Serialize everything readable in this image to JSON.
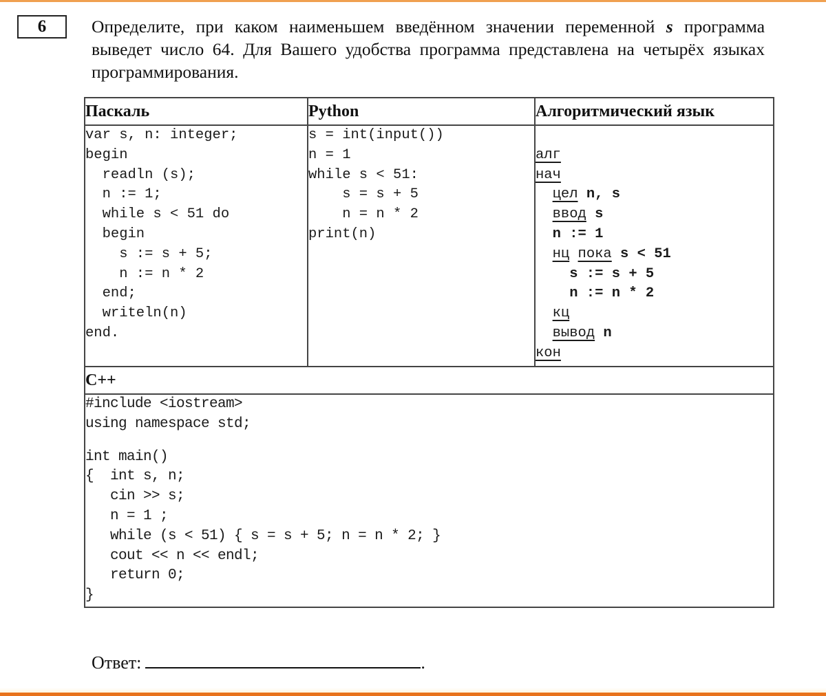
{
  "task": {
    "number": "6",
    "question_part1": "Определите, при каком наименьшем введённом значении переменной ",
    "question_var": "s",
    "question_part2": " программа выведет число 64. Для Вашего удобства программа представлена на четырёх языках программирования."
  },
  "table": {
    "headers": {
      "pascal": "Паскаль",
      "python": "Python",
      "algo": "Алгоритмический язык",
      "cpp": "C++"
    },
    "pascal_lines": [
      "var s, n: integer;",
      "begin",
      "  readln (s);",
      "  n := 1;",
      "  while s < 51 do",
      "  begin",
      "    s := s + 5;",
      "    n := n * 2",
      "  end;",
      "  writeln(n)",
      "end."
    ],
    "python_lines": [
      "s = int(input())",
      "n = 1",
      "while s < 51:",
      "    s = s + 5",
      "    n = n * 2",
      "print(n)"
    ],
    "algo": {
      "l1_kw": "алг",
      "l2_kw": "нач",
      "l3_kw": "цел",
      "l3_rest": " n, s",
      "l4_kw": "ввод",
      "l4_rest": " s",
      "l5": "  n := 1",
      "l6_kw1": "нц",
      "l6_kw2": "пока",
      "l6_rest": " s < 51",
      "l7": "    s := s + 5",
      "l8": "    n := n * 2",
      "l9_kw": "кц",
      "l10_kw": "вывод",
      "l10_rest": " n",
      "l11_kw": "кон"
    },
    "cpp_lines_head": [
      "#include <iostream>",
      "using namespace std;"
    ],
    "cpp_lines_body": [
      "int main()",
      "{  int s, n;",
      "   cin >> s;",
      "   n = 1 ;",
      "   while (s < 51) { s = s + 5; n = n * 2; }",
      "   cout << n << endl;",
      "   return 0;",
      "}"
    ]
  },
  "answer": {
    "label": "Ответ:",
    "dot": "."
  },
  "colors": {
    "top_rule": "#f0a050",
    "bottom_rule": "#e8731c"
  }
}
